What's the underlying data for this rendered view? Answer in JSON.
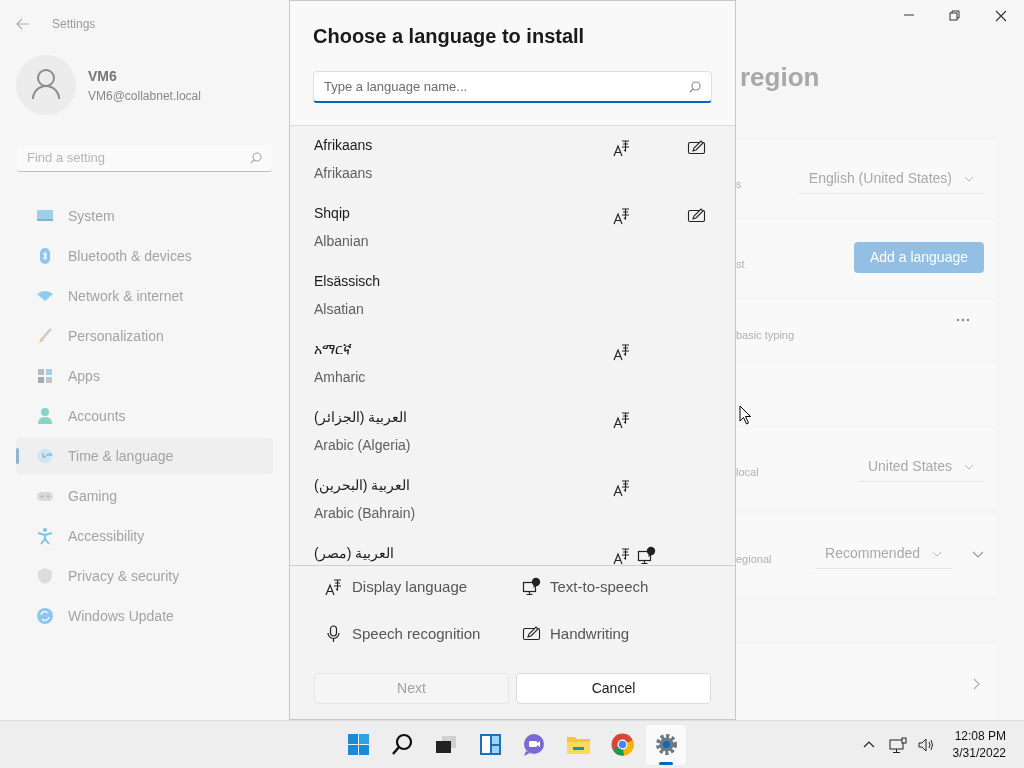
{
  "settings_window": {
    "title": "Settings",
    "user": {
      "name": "VM6",
      "email": "VM6@collabnet.local"
    },
    "search": {
      "placeholder": "Find a setting"
    },
    "nav": [
      {
        "label": "System",
        "kind": "system",
        "selected": false
      },
      {
        "label": "Bluetooth & devices",
        "kind": "bluetooth",
        "selected": false
      },
      {
        "label": "Network & internet",
        "kind": "network",
        "selected": false
      },
      {
        "label": "Personalization",
        "kind": "brush",
        "selected": false
      },
      {
        "label": "Apps",
        "kind": "apps",
        "selected": false
      },
      {
        "label": "Accounts",
        "kind": "accounts",
        "selected": false
      },
      {
        "label": "Time & language",
        "kind": "time",
        "selected": true
      },
      {
        "label": "Gaming",
        "kind": "gaming",
        "selected": false
      },
      {
        "label": "Accessibility",
        "kind": "accessibility",
        "selected": false
      },
      {
        "label": "Privacy & security",
        "kind": "privacy",
        "selected": false
      },
      {
        "label": "Windows Update",
        "kind": "update",
        "selected": false
      }
    ],
    "page_title": "region",
    "cards": [
      {
        "kind": "dropdown",
        "label": "s",
        "value": "English (United States)"
      },
      {
        "kind": "button",
        "label": "st",
        "value": "Add a language"
      },
      {
        "kind": "more",
        "label": "basic typing"
      },
      {
        "kind": "empty"
      },
      {
        "kind": "dropdown",
        "label": "local",
        "value": "United States"
      },
      {
        "kind": "dropdown_expand",
        "label": "egional",
        "value": "Recommended"
      },
      {
        "kind": "link"
      }
    ]
  },
  "dialog": {
    "title": "Choose a language to install",
    "search": {
      "placeholder": "Type a language name..."
    },
    "languages": [
      {
        "native": "Afrikaans",
        "english": "Afrikaans",
        "display": true,
        "tts": false,
        "handwriting": true
      },
      {
        "native": "Shqip",
        "english": "Albanian",
        "display": true,
        "tts": false,
        "handwriting": true
      },
      {
        "native": "Elsässisch",
        "english": "Alsatian",
        "display": false,
        "tts": false,
        "handwriting": false
      },
      {
        "native": "አማርኛ",
        "english": "Amharic",
        "display": true,
        "tts": false,
        "handwriting": false
      },
      {
        "native": "العربية (الجزائر)",
        "english": "Arabic (Algeria)",
        "display": true,
        "tts": false,
        "handwriting": false
      },
      {
        "native": "العربية (البحرين)",
        "english": "Arabic (Bahrain)",
        "display": true,
        "tts": false,
        "handwriting": false
      },
      {
        "native": "العربية (مصر)",
        "display": true,
        "tts": true,
        "handwriting": false
      }
    ],
    "legend": [
      {
        "kind": "display",
        "label": "Display language"
      },
      {
        "kind": "tts",
        "label": "Text-to-speech"
      },
      {
        "kind": "speech",
        "label": "Speech recognition"
      },
      {
        "kind": "handwriting",
        "label": "Handwriting"
      }
    ],
    "buttons": [
      {
        "label": "Next",
        "disabled": true
      },
      {
        "label": "Cancel",
        "disabled": false
      }
    ]
  },
  "taskbar": {
    "apps": [
      {
        "kind": "start",
        "selected": false
      },
      {
        "kind": "search",
        "selected": false
      },
      {
        "kind": "taskview",
        "selected": false
      },
      {
        "kind": "widgets",
        "selected": false
      },
      {
        "kind": "chat",
        "selected": false
      },
      {
        "kind": "explorer",
        "selected": false
      },
      {
        "kind": "chrome",
        "selected": false
      },
      {
        "kind": "settings",
        "selected": true
      }
    ],
    "time": "12:08 PM",
    "date": "3/31/2022"
  }
}
